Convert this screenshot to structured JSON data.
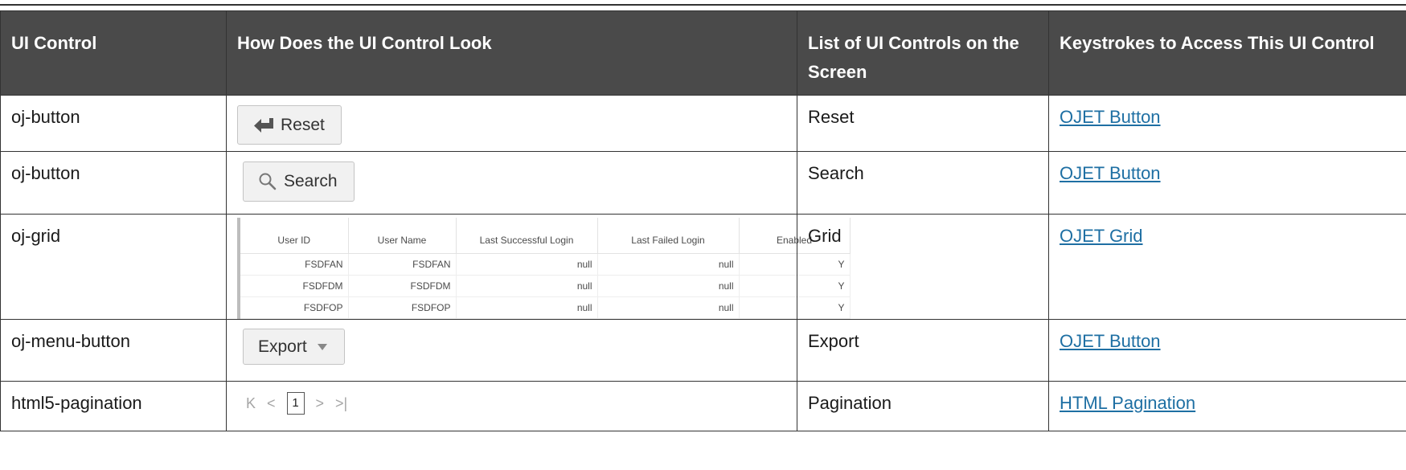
{
  "table": {
    "headers": [
      "UI Control",
      "How Does the UI Control Look",
      "List of UI Controls on the Screen",
      "Keystrokes to Access This UI Control"
    ],
    "rows": [
      {
        "control": "oj-button",
        "screen_name": "Reset",
        "link": "OJET Button",
        "preview": {
          "type": "button",
          "icon": "enter-arrow-icon",
          "label": "Reset"
        }
      },
      {
        "control": "oj-button",
        "screen_name": "Search",
        "link": "OJET Button",
        "preview": {
          "type": "button",
          "icon": "magnifier-icon",
          "label": "Search"
        }
      },
      {
        "control": "oj-grid",
        "screen_name": "Grid",
        "link": "OJET Grid",
        "preview": {
          "type": "grid"
        }
      },
      {
        "control": "oj-menu-button",
        "screen_name": "Export",
        "link": "OJET Button",
        "preview": {
          "type": "menu-button",
          "icon": "caret-down-icon",
          "label": "Export"
        }
      },
      {
        "control": "html5-pagination",
        "screen_name": "Pagination",
        "link": "HTML Pagination",
        "preview": {
          "type": "pagination",
          "current_page": "1"
        }
      }
    ]
  },
  "grid_preview": {
    "columns": [
      "User ID",
      "User Name",
      "Last Successful Login",
      "Last Failed Login",
      "Enabled"
    ],
    "rows": [
      [
        "FSDFAN",
        "FSDFAN",
        "null",
        "null",
        "Y"
      ],
      [
        "FSDFDM",
        "FSDFDM",
        "null",
        "null",
        "Y"
      ],
      [
        "FSDFOP",
        "FSDFOP",
        "null",
        "null",
        "Y"
      ]
    ]
  },
  "pagination_preview": {
    "first_symbol": "K",
    "prev_symbol": "<",
    "current_page": "1",
    "next_symbol": ">",
    "last_symbol": ">|"
  }
}
